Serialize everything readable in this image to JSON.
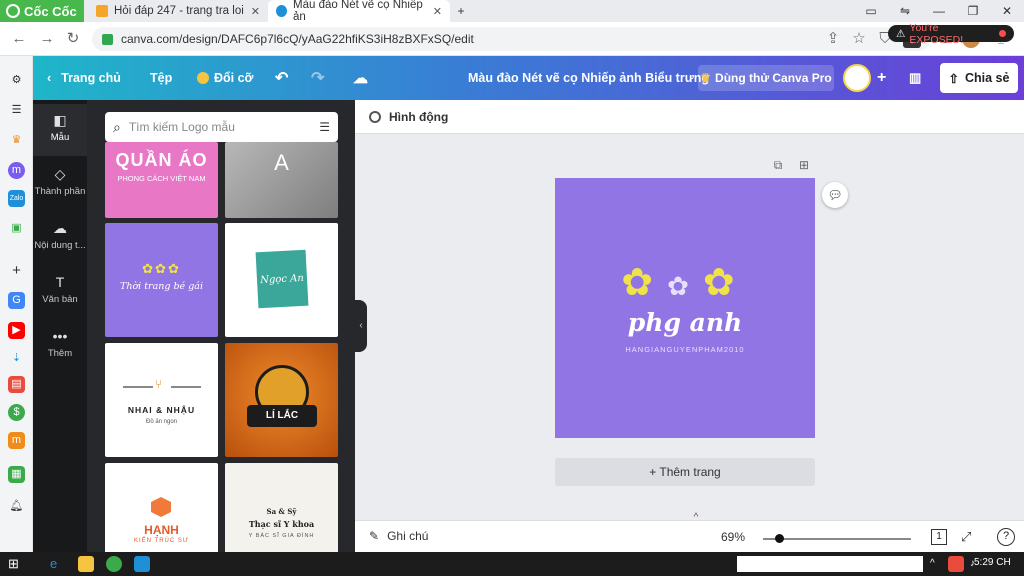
{
  "browser": {
    "brand": "Cốc Cốc",
    "tabs": [
      {
        "label": "Hỏi đáp 247 - trang tra loi",
        "favicon_color": "#f4a52a"
      },
      {
        "label": "Màu đào Nét vẽ cọ Nhiếp ản",
        "favicon_color": "#1f8fd8"
      }
    ],
    "new_tab": "+",
    "url": "canva.com/design/DAFC6p7l6cQ/yAaG22hfiKS3iH8zBXFxSQ/edit",
    "exposed_badge": "You're EXPOSED!"
  },
  "topbar": {
    "home": "Trang chủ",
    "file": "Tệp",
    "resize": "Đổi cỡ",
    "title": "Màu đào Nét vẽ cọ Nhiếp ảnh Biểu trưng",
    "try_pro": "Dùng thử Canva Pro",
    "share": "Chia sẻ"
  },
  "sidenav": [
    {
      "label": "Mẫu",
      "icon": "template-icon"
    },
    {
      "label": "Thành phần",
      "icon": "elements-icon"
    },
    {
      "label": "Nội dung t...",
      "icon": "upload-icon"
    },
    {
      "label": "Văn bản",
      "icon": "text-icon"
    },
    {
      "label": "Thêm",
      "icon": "more-icon"
    }
  ],
  "panel": {
    "search_placeholder": "Tìm kiếm Logo mẫu",
    "tiles": [
      {
        "title": "QUẦN ÁO",
        "subtitle": "PHONG CÁCH VIỆT NAM",
        "bg": "#e877c6"
      },
      {
        "title": "A",
        "subtitle": "",
        "bg": "#9c9c9c"
      },
      {
        "title": "Thời trang bé gái",
        "subtitle": "",
        "bg": "#9275e4"
      },
      {
        "title": "Ngọc An",
        "subtitle": "",
        "bg": "#ffffff"
      },
      {
        "title": "NHAI & NHẬU",
        "subtitle": "Đồ ăn ngon",
        "bg": "#ffffff"
      },
      {
        "title": "LÍ LẮC",
        "subtitle": "",
        "bg": "#e0741f"
      },
      {
        "title": "HẠNH",
        "subtitle": "KIẾN TRÚC SƯ",
        "bg": "#ffffff"
      },
      {
        "title": "Thạc sĩ Y khoa",
        "subtitle": "Sa & Sỹ",
        "tagline": "Y BÁC SĨ GIA ĐÌNH",
        "bg": "#f4f2ec"
      }
    ]
  },
  "editor": {
    "animate": "Hình động",
    "design_title": "phg anh",
    "design_subtitle": "HANGIANGUYENPHAM2010",
    "add_page": "+ Thêm trang",
    "notes": "Ghi chú",
    "zoom": "69%",
    "page_count": "1",
    "help": "?"
  },
  "taskbar": {
    "clock": "5:29 CH"
  },
  "colors": {
    "design_bg": "#9275e4",
    "flower_yellow": "#f2e24a",
    "panel_bg": "#26282c",
    "sidenav_bg": "#18191b"
  }
}
